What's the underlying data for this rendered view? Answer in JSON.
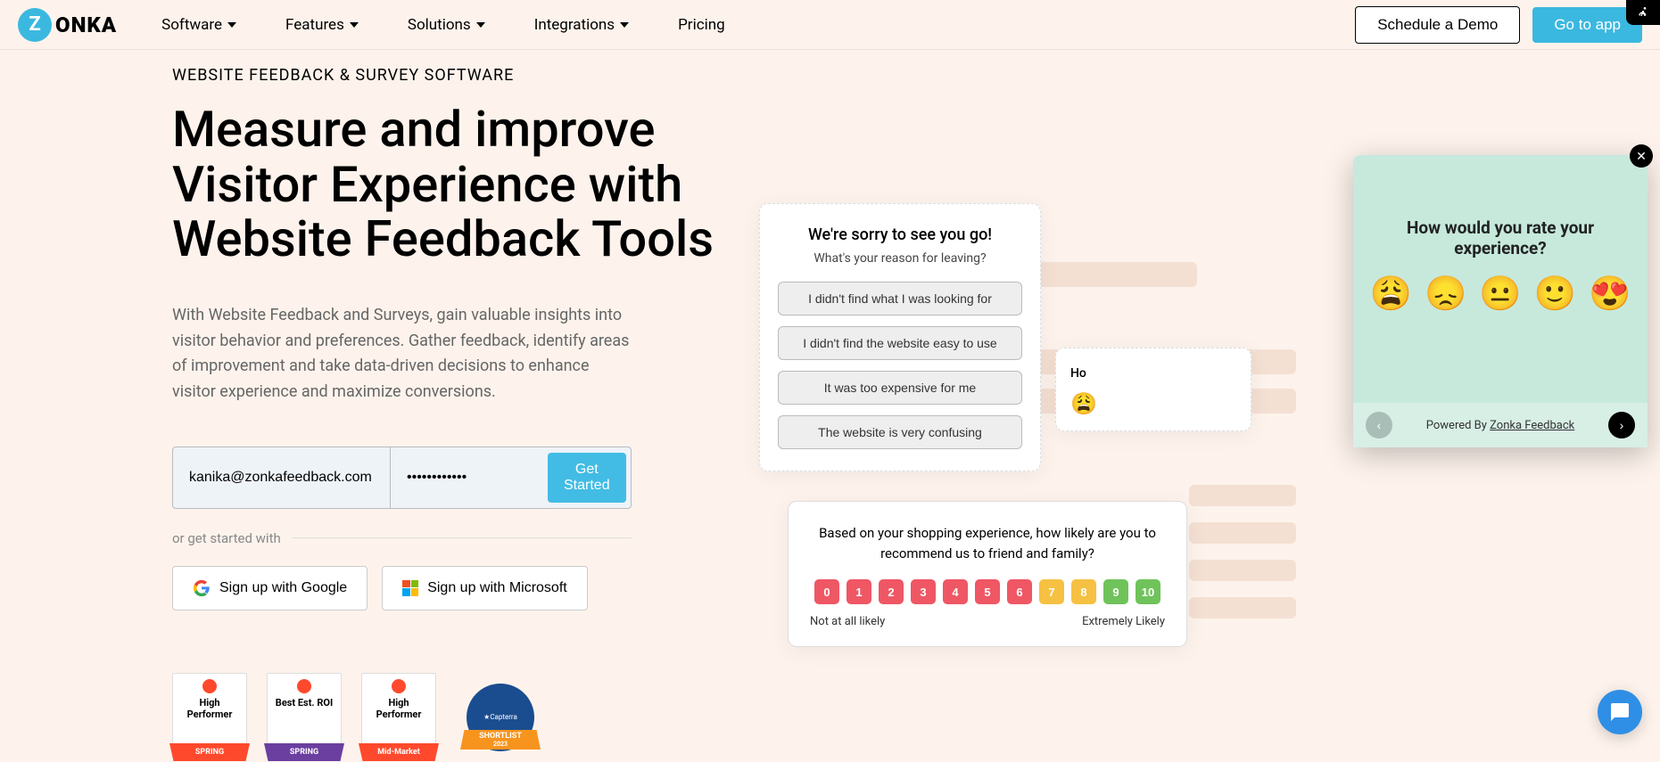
{
  "nav": {
    "logo_letter": "Z",
    "logo_text": "ONKA",
    "items": [
      "Software",
      "Features",
      "Solutions",
      "Integrations",
      "Pricing"
    ],
    "demo": "Schedule a Demo",
    "goto": "Go to app"
  },
  "hero": {
    "eyebrow": "WEBSITE FEEDBACK & SURVEY SOFTWARE",
    "headline": "Measure and improve Visitor Experience with Website Feedback Tools",
    "subhead": "With Website Feedback and Surveys, gain valuable insights into visitor behavior and preferences. Gather feedback, identify areas of improvement and take data-driven decisions to enhance visitor experience and maximize conversions.",
    "email_value": "kanika@zonkafeedback.com",
    "password_value": "••••••••••••",
    "get_started": "Get Started",
    "or_text": "or get started with",
    "google": "Sign up with Google",
    "microsoft": "Sign up with Microsoft"
  },
  "badges": [
    {
      "title": "High Performer",
      "ribbon": "SPRING",
      "ribbon_color": "red"
    },
    {
      "title": "Best Est. ROI",
      "ribbon": "SPRING",
      "ribbon_color": "purple"
    },
    {
      "title": "High Performer",
      "ribbon": "Mid-Market",
      "ribbon_color": "red"
    }
  ],
  "capterra": {
    "label": "Capterra",
    "banner": "SHORTLIST",
    "year": "2023"
  },
  "widget_exit": {
    "title": "We're sorry to see you go!",
    "sub": "What's your reason for leaving?",
    "options": [
      "I didn't find what I was looking for",
      "I didn't find the website easy to use",
      "It was too expensive for me",
      "The website is very confusing"
    ]
  },
  "widget_peek": {
    "title_partial": "Ho",
    "emoji_partial": "😩"
  },
  "widget_nps": {
    "question": "Based on your shopping experience, how likely are you to recommend us to friend and family?",
    "scale": [
      {
        "n": "0",
        "color": "#ef5765"
      },
      {
        "n": "1",
        "color": "#ef5765"
      },
      {
        "n": "2",
        "color": "#ef5765"
      },
      {
        "n": "3",
        "color": "#ef5765"
      },
      {
        "n": "4",
        "color": "#ef5765"
      },
      {
        "n": "5",
        "color": "#ef5765"
      },
      {
        "n": "6",
        "color": "#ef5765"
      },
      {
        "n": "7",
        "color": "#f6c142"
      },
      {
        "n": "8",
        "color": "#f6c142"
      },
      {
        "n": "9",
        "color": "#6fc35a"
      },
      {
        "n": "10",
        "color": "#6fc35a"
      }
    ],
    "low": "Not at all likely",
    "high": "Extremely Likely"
  },
  "overlay": {
    "question": "How would you rate your experience?",
    "emojis": [
      "😩",
      "😞",
      "😐",
      "🙂",
      "😍"
    ],
    "powered_prefix": "Powered By ",
    "powered_link": "Zonka Feedback"
  }
}
